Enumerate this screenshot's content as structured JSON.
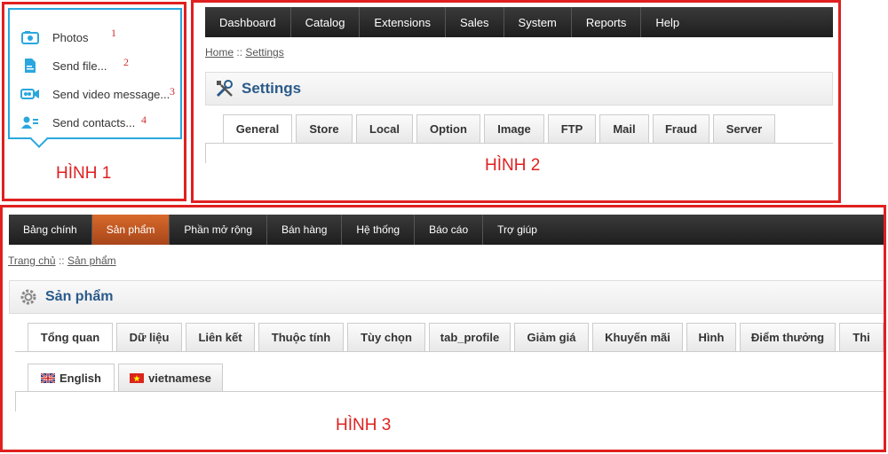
{
  "figure1": {
    "caption": "HÌNH 1",
    "items": [
      {
        "label": "Photos",
        "num": "1",
        "icon": "photo-icon"
      },
      {
        "label": "Send file...",
        "num": "2",
        "icon": "file-icon"
      },
      {
        "label": "Send video message...",
        "num": "3",
        "icon": "video-icon"
      },
      {
        "label": "Send contacts...",
        "num": "4",
        "icon": "contacts-icon"
      }
    ],
    "accent": "#2aa7df"
  },
  "figure2": {
    "caption": "HÌNH 2",
    "nav": [
      "Dashboard",
      "Catalog",
      "Extensions",
      "Sales",
      "System",
      "Reports",
      "Help"
    ],
    "breadcrumb": {
      "home": "Home",
      "sep": "::",
      "current": "Settings"
    },
    "title": "Settings",
    "tabs": [
      "General",
      "Store",
      "Local",
      "Option",
      "Image",
      "FTP",
      "Mail",
      "Fraud",
      "Server"
    ]
  },
  "figure3": {
    "caption": "HÌNH 3",
    "nav": [
      "Bảng chính",
      "Sản phẩm",
      "Phần mở rộng",
      "Bán hàng",
      "Hệ thống",
      "Báo cáo",
      "Trợ giúp"
    ],
    "breadcrumb": {
      "home": "Trang chủ",
      "sep": "::",
      "current": "Sản phẩm"
    },
    "title": "Sản phẩm",
    "tabs": [
      "Tổng quan",
      "Dữ liệu",
      "Liên kết",
      "Thuộc tính",
      "Tùy chọn",
      "tab_profile",
      "Giảm giá",
      "Khuyến mãi",
      "Hình",
      "Điểm thưởng",
      "Thi"
    ],
    "lang_tabs": [
      "English",
      "vietnamese"
    ],
    "active_nav_color": "#c8561f"
  },
  "frame_color": "#e02020"
}
